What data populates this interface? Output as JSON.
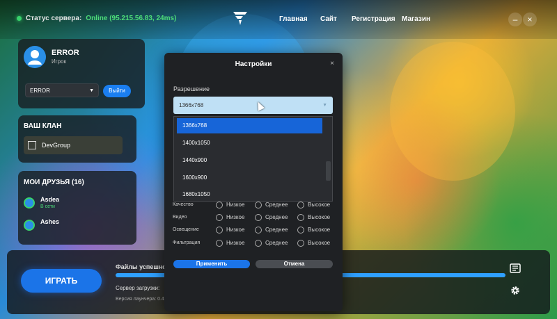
{
  "topbar": {
    "status_label": "Статус сервера:",
    "status_value": "Online (95.215.56.83, 24ms)",
    "nav": [
      "Главная",
      "Сайт",
      "Регистрация",
      "Магазин"
    ],
    "minimize_label": "–",
    "close_label": "×"
  },
  "profile": {
    "name": "ERROR",
    "role": "Игрок",
    "account_select": "ERROR",
    "logout_label": "Выйти"
  },
  "clan": {
    "title": "ВАШ КЛАН",
    "name": "DevGroup"
  },
  "friends": {
    "title": "МОИ ДРУЗЬЯ (16)",
    "items": [
      {
        "name": "Asdea",
        "status": "В сети"
      },
      {
        "name": "Ashes",
        "status": ""
      }
    ]
  },
  "bottom": {
    "play_label": "ИГРАТЬ",
    "files_text": "Файлы успешно",
    "server_label": "Сервер загрузки:",
    "version_text": "Версия лаунчера: 0.4"
  },
  "settings": {
    "title": "Настройки",
    "close_label": "×",
    "resolution_label": "Разрешение",
    "resolution_value": "1366x768",
    "options": [
      "1366x768",
      "1400x1050",
      "1440x900",
      "1600x900",
      "1680x1050"
    ],
    "rows": [
      {
        "label": "Качество",
        "choices": [
          "Низкое",
          "Среднее",
          "Высокое"
        ]
      },
      {
        "label": "Видео",
        "choices": [
          "Низкое",
          "Среднее",
          "Высокое"
        ]
      },
      {
        "label": "Освещение",
        "choices": [
          "Низкое",
          "Среднее",
          "Высокое"
        ]
      },
      {
        "label": "Фильтрация",
        "choices": [
          "Низкое",
          "Среднее",
          "Высокое"
        ]
      }
    ],
    "apply_label": "Применить",
    "cancel_label": "Отмена"
  },
  "colors": {
    "accent": "#1b74e8",
    "online": "#4ddc78",
    "selected_option": "#1765d8"
  }
}
